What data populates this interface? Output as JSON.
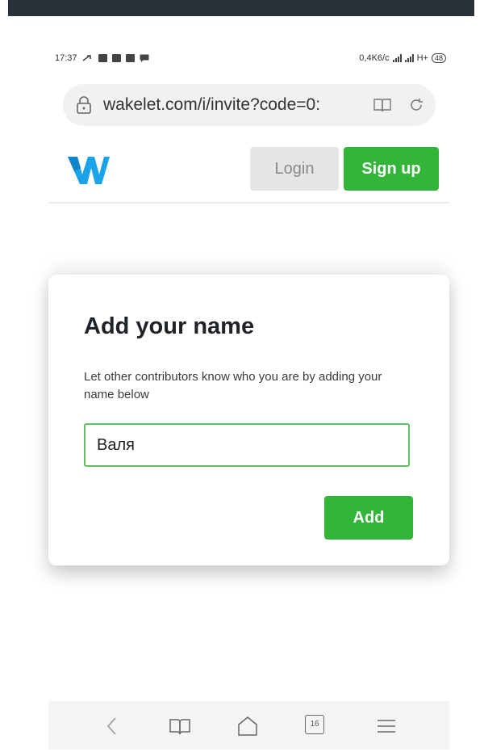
{
  "status_bar": {
    "time": "17:37",
    "network_speed": "0,4K6/c",
    "network_type": "H+",
    "battery": "48"
  },
  "browser": {
    "url": "wakelet.com/i/invite?code=0:",
    "tabs_count": "16"
  },
  "site": {
    "logo_icon": "wakelet-w-logo",
    "login_label": "Login",
    "signup_label": "Sign up"
  },
  "dialog": {
    "title": "Add your name",
    "description": "Let other contributors know who you are by adding your name below",
    "name_value": "Валя",
    "add_label": "Add"
  },
  "colors": {
    "accent_green": "#33b53a",
    "logo_blue": "#1aa3e8",
    "login_gray": "#e5e5e5"
  }
}
